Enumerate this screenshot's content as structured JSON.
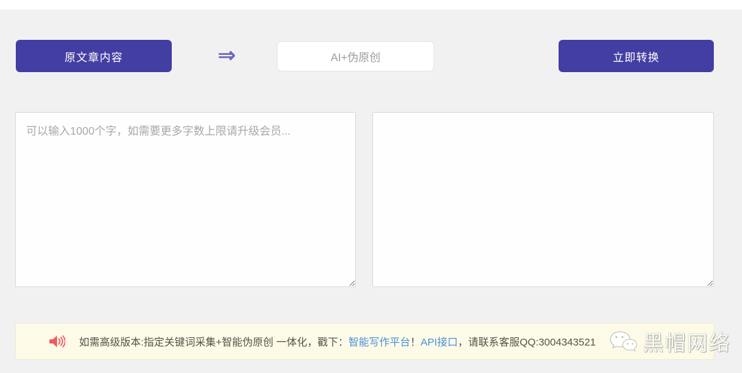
{
  "page": {
    "background_color": "#f1f1f2",
    "accent_color": "#433ea2"
  },
  "toolbar": {
    "source_label": "原文章内容",
    "arrow_glyph": "⇒",
    "mode_label": "AI+伪原创",
    "convert_label": "立即转换"
  },
  "editors": {
    "input_placeholder": "可以输入1000个字，如需要更多字数上限请升级会员...",
    "input_value": "",
    "output_value": ""
  },
  "notice": {
    "icon": "speaker-icon",
    "icon_color": "#f2595f",
    "text_before": "如需高级版本:指定关键词采集+智能伪原创 一体化，戳下：",
    "link_platform": "智能写作平台",
    "separator": "！",
    "link_api": "API接口",
    "text_after": "，请联系客服QQ:3004343521",
    "qq_number": "3004343521",
    "link_color": "#4a8fdc",
    "bar_color": "#fdfbe7"
  },
  "watermark": {
    "logo": "wechat-bubbles-icon",
    "label": "黑帽网络"
  }
}
